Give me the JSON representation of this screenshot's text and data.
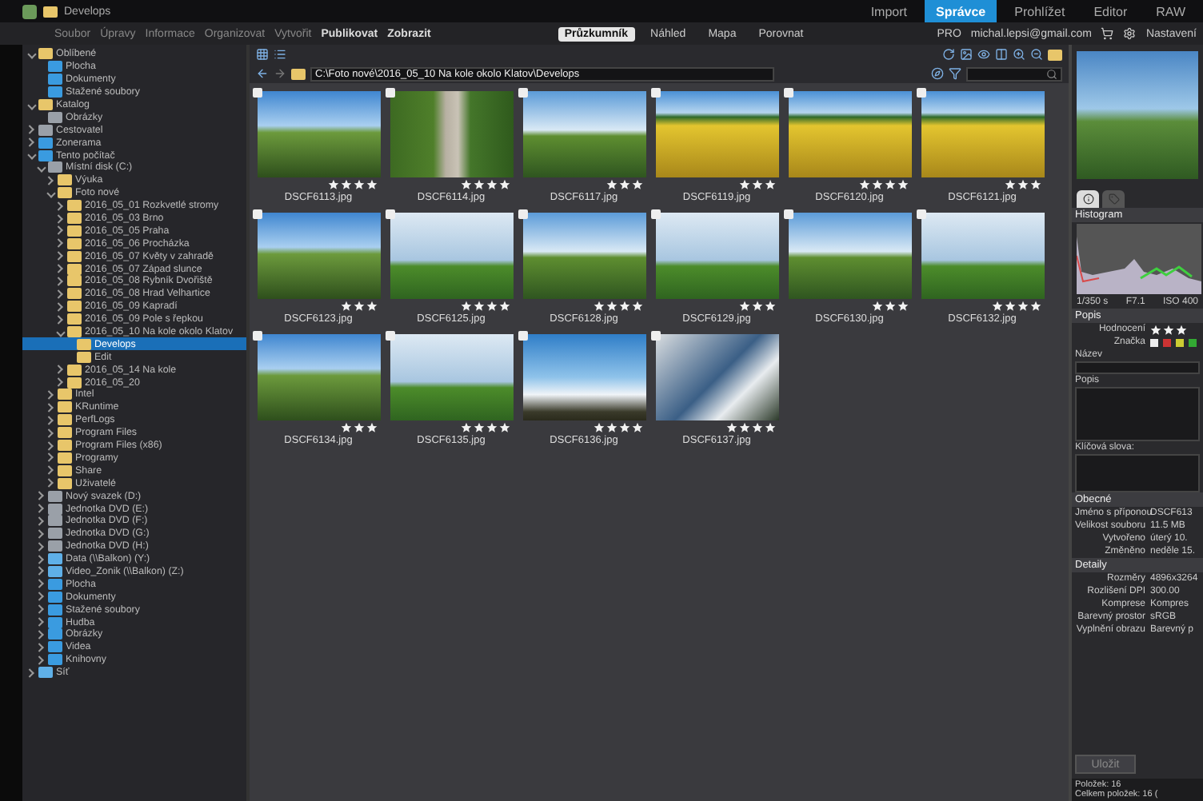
{
  "window": {
    "title": "Develops"
  },
  "menu": [
    "Soubor",
    "Úpravy",
    "Informace",
    "Organizovat",
    "Vytvořit",
    "Publikovat",
    "Zobrazit"
  ],
  "modes": [
    {
      "label": "Import",
      "selected": false
    },
    {
      "label": "Správce",
      "selected": true
    },
    {
      "label": "Prohlížet",
      "selected": false
    },
    {
      "label": "Editor",
      "selected": false
    },
    {
      "label": "RAW",
      "selected": false
    }
  ],
  "views": [
    {
      "label": "Průzkumník",
      "selected": true
    },
    {
      "label": "Náhled",
      "selected": false
    },
    {
      "label": "Mapa",
      "selected": false
    },
    {
      "label": "Porovnat",
      "selected": false
    }
  ],
  "account": {
    "edition": "PRO",
    "email": "michal.lepsi@gmail.com",
    "settings": "Nastavení"
  },
  "path": "C:\\Foto nové\\2016_05_10 Na kole okolo Klatov\\Develops",
  "tree": [
    {
      "label": "Oblíbené",
      "kind": "folder",
      "expanded": true,
      "selected": false,
      "children": [
        {
          "label": "Plocha",
          "kind": "special",
          "selected": false
        },
        {
          "label": "Dokumenty",
          "kind": "special",
          "selected": false
        },
        {
          "label": "Stažené soubory",
          "kind": "special",
          "selected": false
        }
      ]
    },
    {
      "label": "Katalog",
      "kind": "folder",
      "expanded": true,
      "selected": false,
      "children": [
        {
          "label": "Obrázky",
          "kind": "drive",
          "selected": false
        }
      ]
    },
    {
      "label": "Cestovatel",
      "kind": "drive",
      "expanded": false,
      "selected": false
    },
    {
      "label": "Zonerama",
      "kind": "special",
      "expanded": false,
      "selected": false
    },
    {
      "label": "Tento počítač",
      "kind": "special",
      "expanded": true,
      "selected": false,
      "children": [
        {
          "label": "Místní disk (C:)",
          "kind": "drive",
          "expanded": true,
          "selected": false,
          "children": [
            {
              "label": "Výuka",
              "kind": "folder",
              "expanded": false,
              "selected": false
            },
            {
              "label": "Foto nové",
              "kind": "folder",
              "expanded": true,
              "selected": false,
              "children": [
                {
                  "label": "2016_05_01 Rozkvetlé stromy",
                  "kind": "folder",
                  "expanded": false,
                  "selected": false
                },
                {
                  "label": "2016_05_03 Brno",
                  "kind": "folder",
                  "expanded": false,
                  "selected": false
                },
                {
                  "label": "2016_05_05 Praha",
                  "kind": "folder",
                  "expanded": false,
                  "selected": false
                },
                {
                  "label": "2016_05_06 Procházka",
                  "kind": "folder",
                  "expanded": false,
                  "selected": false
                },
                {
                  "label": "2016_05_07 Květy v zahradě",
                  "kind": "folder",
                  "expanded": false,
                  "selected": false
                },
                {
                  "label": "2016_05_07 Západ slunce",
                  "kind": "folder",
                  "expanded": false,
                  "selected": false
                },
                {
                  "label": "2016_05_08 Rybník Dvořiště",
                  "kind": "folder",
                  "expanded": false,
                  "selected": false
                },
                {
                  "label": "2016_05_08 Hrad Velhartice",
                  "kind": "folder",
                  "expanded": false,
                  "selected": false
                },
                {
                  "label": "2016_05_09 Kapradí",
                  "kind": "folder",
                  "expanded": false,
                  "selected": false
                },
                {
                  "label": "2016_05_09 Pole s řepkou",
                  "kind": "folder",
                  "expanded": false,
                  "selected": false
                },
                {
                  "label": "2016_05_10 Na kole okolo Klatov",
                  "kind": "folder",
                  "expanded": true,
                  "selected": false,
                  "children": [
                    {
                      "label": "Develops",
                      "kind": "folder",
                      "selected": true
                    },
                    {
                      "label": "Edit",
                      "kind": "folder",
                      "selected": false
                    }
                  ]
                },
                {
                  "label": "2016_05_14 Na kole",
                  "kind": "folder",
                  "expanded": false,
                  "selected": false
                },
                {
                  "label": "2016_05_20",
                  "kind": "folder",
                  "expanded": false,
                  "selected": false
                }
              ]
            },
            {
              "label": "Intel",
              "kind": "folder",
              "expanded": false,
              "selected": false
            },
            {
              "label": "KRuntime",
              "kind": "folder",
              "expanded": false,
              "selected": false
            },
            {
              "label": "PerfLogs",
              "kind": "folder",
              "expanded": false,
              "selected": false
            },
            {
              "label": "Program Files",
              "kind": "folder",
              "expanded": false,
              "selected": false
            },
            {
              "label": "Program Files (x86)",
              "kind": "folder",
              "expanded": false,
              "selected": false
            },
            {
              "label": "Programy",
              "kind": "folder",
              "expanded": false,
              "selected": false
            },
            {
              "label": "Share",
              "kind": "folder",
              "expanded": false,
              "selected": false
            },
            {
              "label": "Uživatelé",
              "kind": "folder",
              "expanded": false,
              "selected": false
            }
          ]
        },
        {
          "label": "Nový svazek (D:)",
          "kind": "drive",
          "expanded": false,
          "selected": false
        },
        {
          "label": "Jednotka DVD (E:)",
          "kind": "drive",
          "expanded": false,
          "selected": false
        },
        {
          "label": "Jednotka DVD (F:)",
          "kind": "drive",
          "expanded": false,
          "selected": false
        },
        {
          "label": "Jednotka DVD (G:)",
          "kind": "drive",
          "expanded": false,
          "selected": false
        },
        {
          "label": "Jednotka DVD (H:)",
          "kind": "drive",
          "expanded": false,
          "selected": false
        },
        {
          "label": "Data (\\\\Balkon) (Y:)",
          "kind": "network",
          "expanded": false,
          "selected": false
        },
        {
          "label": "Video_Zonik (\\\\Balkon) (Z:)",
          "kind": "network",
          "expanded": false,
          "selected": false
        },
        {
          "label": "Plocha",
          "kind": "special",
          "expanded": false,
          "selected": false
        },
        {
          "label": "Dokumenty",
          "kind": "special",
          "expanded": false,
          "selected": false
        },
        {
          "label": "Stažené soubory",
          "kind": "special",
          "expanded": false,
          "selected": false
        },
        {
          "label": "Hudba",
          "kind": "special",
          "expanded": false,
          "selected": false
        },
        {
          "label": "Obrázky",
          "kind": "special",
          "expanded": false,
          "selected": false
        },
        {
          "label": "Videa",
          "kind": "special",
          "expanded": false,
          "selected": false
        },
        {
          "label": "Knihovny",
          "kind": "special",
          "expanded": false,
          "selected": false
        }
      ]
    },
    {
      "label": "Síť",
      "kind": "network",
      "expanded": false,
      "selected": false
    }
  ],
  "thumbnails": [
    {
      "name": "DSCF6113.jpg",
      "stars": 4,
      "selected": false
    },
    {
      "name": "DSCF6114.jpg",
      "stars": 4,
      "selected": false
    },
    {
      "name": "DSCF6117.jpg",
      "stars": 3,
      "selected": false
    },
    {
      "name": "DSCF6119.jpg",
      "stars": 3,
      "selected": false
    },
    {
      "name": "DSCF6120.jpg",
      "stars": 4,
      "selected": false
    },
    {
      "name": "DSCF6121.jpg",
      "stars": 3,
      "selected": false
    },
    {
      "name": "DSCF6123.jpg",
      "stars": 3,
      "selected": false
    },
    {
      "name": "DSCF6125.jpg",
      "stars": 4,
      "selected": false
    },
    {
      "name": "DSCF6128.jpg",
      "stars": 4,
      "selected": false
    },
    {
      "name": "DSCF6129.jpg",
      "stars": 3,
      "selected": false
    },
    {
      "name": "DSCF6130.jpg",
      "stars": 3,
      "selected": false
    },
    {
      "name": "DSCF6132.jpg",
      "stars": 4,
      "selected": false
    },
    {
      "name": "DSCF6134.jpg",
      "stars": 3,
      "selected": false
    },
    {
      "name": "DSCF6135.jpg",
      "stars": 4,
      "selected": false
    },
    {
      "name": "DSCF6136.jpg",
      "stars": 4,
      "selected": false
    },
    {
      "name": "DSCF6137.jpg",
      "stars": 4,
      "selected": false
    }
  ],
  "info": {
    "histogram_title": "Histogram",
    "exif": [
      "1/350 s",
      "F7.1",
      "ISO 400"
    ],
    "description_title": "Popis",
    "rating_label": "Hodnocení",
    "rating": {
      "stars": 3
    },
    "tag_label": "Značka",
    "name_label": "Název",
    "caption_label": "Popis",
    "keywords_label": "Klíčová slova:",
    "general_title": "Obecné",
    "general": [
      {
        "label": "Jméno s příponou",
        "value": "DSCF613"
      },
      {
        "label": "Velikost souboru",
        "value": "11.5 MB"
      },
      {
        "label": "Vytvořeno",
        "value": "úterý 10."
      },
      {
        "label": "Změněno",
        "value": "neděle 15."
      }
    ],
    "details_title": "Detaily",
    "details": [
      {
        "label": "Rozměry",
        "value": "4896x3264"
      },
      {
        "label": "Rozlišení DPI",
        "value": "300.00"
      },
      {
        "label": "Komprese",
        "value": "Kompres"
      },
      {
        "label": "Barevný prostor",
        "value": "sRGB"
      },
      {
        "label": "Vyplnění obrazu",
        "value": "Barevný p"
      }
    ],
    "save": "Uložit"
  },
  "status": {
    "items": "Položek: 16",
    "total": "Celkem položek: 16 ("
  }
}
